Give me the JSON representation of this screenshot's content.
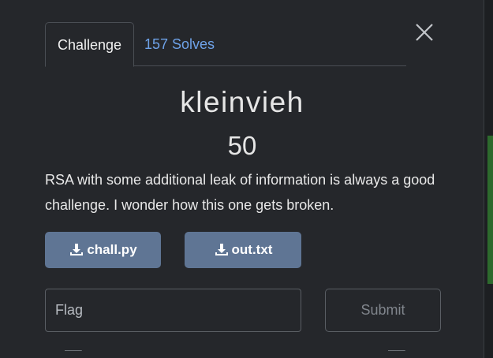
{
  "tabs": {
    "challenge_label": "Challenge",
    "solves_label": "157 Solves"
  },
  "challenge": {
    "name": "kleinvieh",
    "points": "50",
    "description": "RSA with some additional leak of information is always a good challenge. I wonder how this one gets broken."
  },
  "files": [
    {
      "label": "chall.py",
      "icon": "download-icon"
    },
    {
      "label": "out.txt",
      "icon": "download-icon"
    }
  ],
  "form": {
    "flag_placeholder": "Flag",
    "flag_value": "",
    "submit_label": "Submit"
  },
  "close_icon": "close-icon",
  "colors": {
    "accent_link": "#6ea2e8",
    "file_button": "#5f7594",
    "modal_bg": "#25272b",
    "side_accent": "#2d6a2d"
  }
}
